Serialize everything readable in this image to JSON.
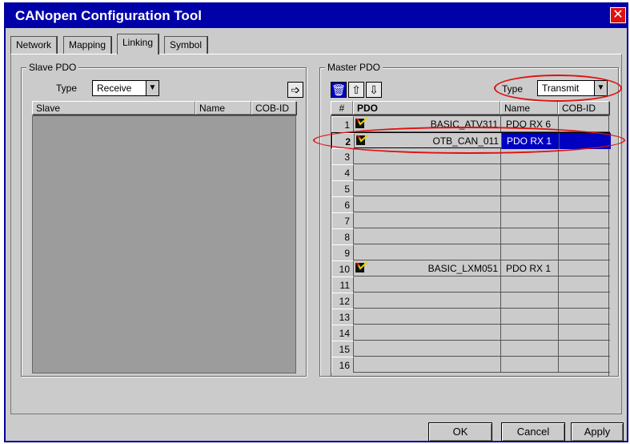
{
  "window": {
    "title": "CANopen Configuration Tool"
  },
  "tabs": [
    {
      "label": "Network",
      "active": false
    },
    {
      "label": "Mapping",
      "active": false
    },
    {
      "label": "Linking",
      "active": true
    },
    {
      "label": "Symbol",
      "active": false
    }
  ],
  "slave_pdo": {
    "title": "Slave PDO",
    "type_label": "Type",
    "type_value": "Receive",
    "columns": [
      "Slave",
      "Name",
      "COB-ID"
    ]
  },
  "master_pdo": {
    "title": "Master PDO",
    "type_label": "Type",
    "type_value": "Transmit",
    "columns": [
      "#",
      "PDO",
      "Name",
      "COB-ID"
    ],
    "rows": [
      {
        "num": "1",
        "pdo": "BASIC_ATV311",
        "name": "PDO RX 6",
        "cob": "",
        "has_icon": true,
        "selected": false
      },
      {
        "num": "2",
        "pdo": "OTB_CAN_011",
        "name": "PDO RX 1",
        "cob": "",
        "has_icon": true,
        "selected": true
      },
      {
        "num": "3",
        "pdo": "",
        "name": "",
        "cob": "",
        "has_icon": false,
        "selected": false
      },
      {
        "num": "4",
        "pdo": "",
        "name": "",
        "cob": "",
        "has_icon": false,
        "selected": false
      },
      {
        "num": "5",
        "pdo": "",
        "name": "",
        "cob": "",
        "has_icon": false,
        "selected": false
      },
      {
        "num": "6",
        "pdo": "",
        "name": "",
        "cob": "",
        "has_icon": false,
        "selected": false
      },
      {
        "num": "7",
        "pdo": "",
        "name": "",
        "cob": "",
        "has_icon": false,
        "selected": false
      },
      {
        "num": "8",
        "pdo": "",
        "name": "",
        "cob": "",
        "has_icon": false,
        "selected": false
      },
      {
        "num": "9",
        "pdo": "",
        "name": "",
        "cob": "",
        "has_icon": false,
        "selected": false
      },
      {
        "num": "10",
        "pdo": "BASIC_LXM051",
        "name": "PDO RX 1",
        "cob": "",
        "has_icon": true,
        "selected": false
      },
      {
        "num": "11",
        "pdo": "",
        "name": "",
        "cob": "",
        "has_icon": false,
        "selected": false
      },
      {
        "num": "12",
        "pdo": "",
        "name": "",
        "cob": "",
        "has_icon": false,
        "selected": false
      },
      {
        "num": "13",
        "pdo": "",
        "name": "",
        "cob": "",
        "has_icon": false,
        "selected": false
      },
      {
        "num": "14",
        "pdo": "",
        "name": "",
        "cob": "",
        "has_icon": false,
        "selected": false
      },
      {
        "num": "15",
        "pdo": "",
        "name": "",
        "cob": "",
        "has_icon": false,
        "selected": false
      },
      {
        "num": "16",
        "pdo": "",
        "name": "",
        "cob": "",
        "has_icon": false,
        "selected": false
      }
    ]
  },
  "icons": {
    "close": "close-icon",
    "transfer": "arrow-right-icon",
    "delete": "trash-icon",
    "move_up": "arrow-up-icon",
    "move_down": "arrow-down-icon",
    "pdo_entry": "pdo-link-icon"
  },
  "buttons": {
    "ok": "OK",
    "cancel": "Cancel",
    "apply": "Apply"
  },
  "colors": {
    "titlebar": "#0000a8",
    "selection": "#0000c0",
    "annotation": "#e01010"
  }
}
